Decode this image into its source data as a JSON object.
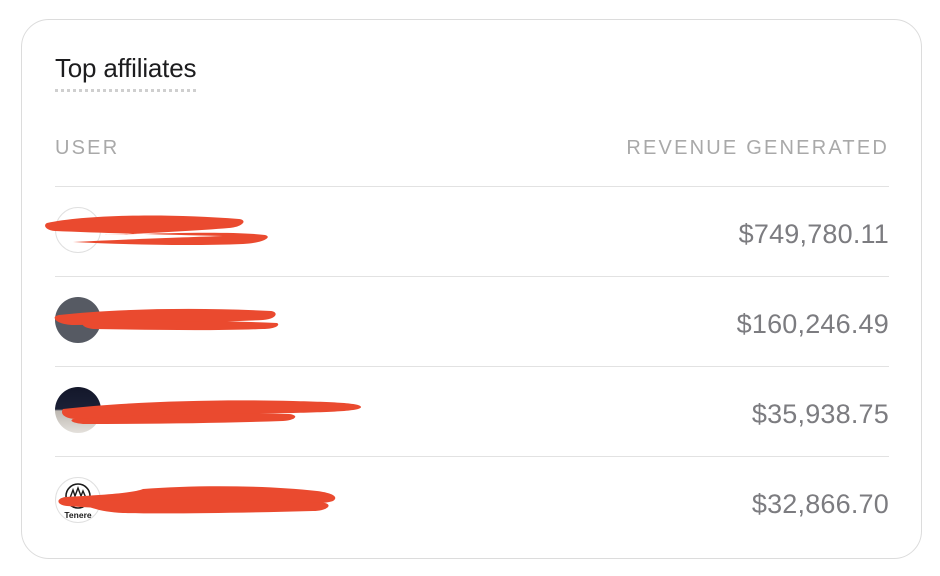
{
  "card": {
    "title": "Top affiliates"
  },
  "table": {
    "columns": {
      "user": "USER",
      "revenue": "REVENUE GENERATED"
    },
    "rows": [
      {
        "user": "",
        "avatar": "light-circle",
        "revenue": "$749,780.11"
      },
      {
        "user": "",
        "avatar": "gray-circle",
        "revenue": "$160,246.49"
      },
      {
        "user": "",
        "avatar": "dark-photo",
        "revenue": "$35,938.75"
      },
      {
        "user": "",
        "avatar": "tenere-logo",
        "avatar_text": "Tenere",
        "revenue": "$32,866.70"
      }
    ]
  },
  "colors": {
    "redaction": "#ea4a2f",
    "revenue_text": "#7c7c80",
    "header_text": "#a9a9a9",
    "title_text": "#1c1c1e",
    "divider": "#e2e2e2"
  }
}
